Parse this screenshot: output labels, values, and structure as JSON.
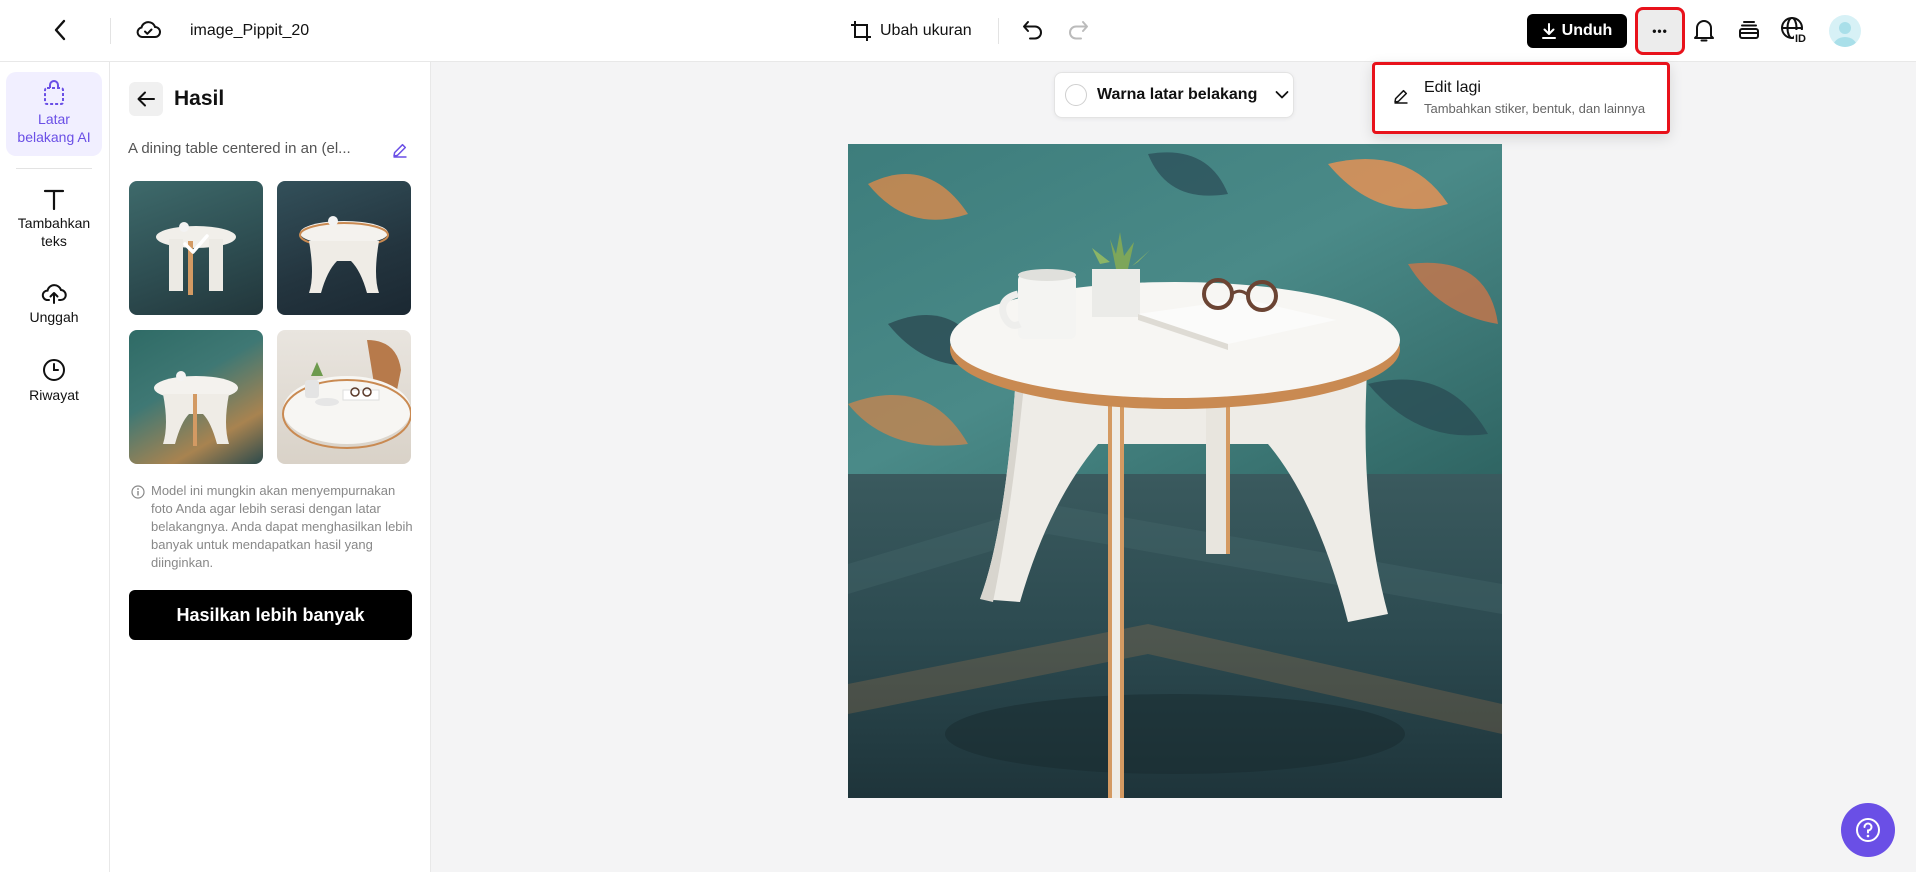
{
  "header": {
    "filename": "image_Pippit_20",
    "resize_label": "Ubah ukuran",
    "download_label": "Unduh",
    "more_label": "•••"
  },
  "dropdown": {
    "title": "Edit lagi",
    "subtitle": "Tambahkan stiker, bentuk, dan lainnya"
  },
  "rail": {
    "items": [
      {
        "label": "Latar belakang AI",
        "icon": "bag-icon"
      },
      {
        "label": "Tambahkan teks",
        "icon": "text-icon"
      },
      {
        "label": "Unggah",
        "icon": "upload-cloud-icon"
      },
      {
        "label": "Riwayat",
        "icon": "clock-icon"
      }
    ]
  },
  "panel": {
    "title": "Hasil",
    "prompt": "A dining table centered in an (el...",
    "info": "Model ini mungkin akan menyempurnakan foto Anda agar lebih serasi dengan latar belakangnya. Anda dapat menghasilkan lebih banyak untuk mendapatkan hasil yang diinginkan.",
    "generate_label": "Hasilkan lebih banyak"
  },
  "canvas": {
    "bg_color_label": "Warna latar belakang"
  },
  "colors": {
    "accent": "#6a4fe6",
    "highlight": "#e8121b",
    "primary_button": "#000000"
  }
}
